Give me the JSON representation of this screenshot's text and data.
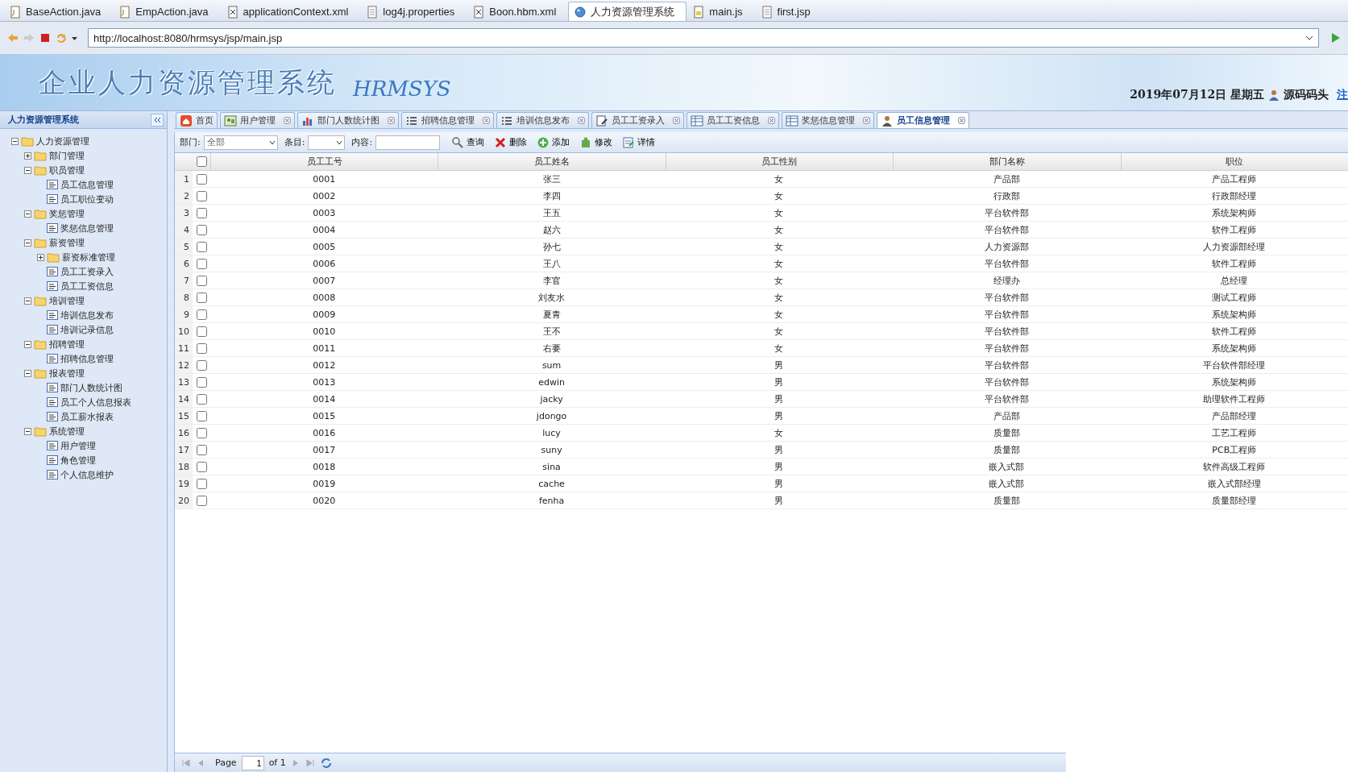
{
  "editor_tabs": [
    {
      "label": "BaseAction.java",
      "kind": "java",
      "selected": false
    },
    {
      "label": "EmpAction.java",
      "kind": "java",
      "selected": false
    },
    {
      "label": "applicationContext.xml",
      "kind": "xml",
      "selected": false
    },
    {
      "label": "log4j.properties",
      "kind": "text",
      "selected": false
    },
    {
      "label": "Boon.hbm.xml",
      "kind": "xml",
      "selected": false
    },
    {
      "label": "人力资源管理系统",
      "kind": "web",
      "selected": true
    },
    {
      "label": "main.js",
      "kind": "js",
      "selected": false
    },
    {
      "label": "first.jsp",
      "kind": "text",
      "selected": false
    }
  ],
  "address_bar": {
    "url": "http://localhost:8080/hrmsys/jsp/main.jsp"
  },
  "header": {
    "title": "企业人力资源管理系统",
    "subtitle": "HRMSYS",
    "date": "2019年07月12日 星期五",
    "user": "源码码头",
    "logout": "注"
  },
  "sidebar": {
    "title": "人力资源管理系统",
    "tree": [
      {
        "label": "人力资源管理",
        "kind": "folder",
        "expanded": true,
        "children": [
          {
            "label": "部门管理",
            "kind": "folder",
            "expanded": false
          },
          {
            "label": "职员管理",
            "kind": "folder",
            "expanded": true,
            "children": [
              {
                "label": "员工信息管理",
                "kind": "page"
              },
              {
                "label": "员工职位变动",
                "kind": "page"
              }
            ]
          },
          {
            "label": "奖惩管理",
            "kind": "folder",
            "expanded": true,
            "children": [
              {
                "label": "奖惩信息管理",
                "kind": "page"
              }
            ]
          },
          {
            "label": "薪资管理",
            "kind": "folder",
            "expanded": true,
            "children": [
              {
                "label": "薪资标准管理",
                "kind": "folder",
                "expanded": false
              },
              {
                "label": "员工工资录入",
                "kind": "page"
              },
              {
                "label": "员工工资信息",
                "kind": "page"
              }
            ]
          },
          {
            "label": "培训管理",
            "kind": "folder",
            "expanded": true,
            "children": [
              {
                "label": "培训信息发布",
                "kind": "page"
              },
              {
                "label": "培训记录信息",
                "kind": "page"
              }
            ]
          },
          {
            "label": "招聘管理",
            "kind": "folder",
            "expanded": true,
            "children": [
              {
                "label": "招聘信息管理",
                "kind": "page"
              }
            ]
          },
          {
            "label": "报表管理",
            "kind": "folder",
            "expanded": true,
            "children": [
              {
                "label": "部门人数统计图",
                "kind": "page"
              },
              {
                "label": "员工个人信息报表",
                "kind": "page"
              },
              {
                "label": "员工薪水报表",
                "kind": "page"
              }
            ]
          },
          {
            "label": "系统管理",
            "kind": "folder",
            "expanded": true,
            "children": [
              {
                "label": "用户管理",
                "kind": "page"
              },
              {
                "label": "角色管理",
                "kind": "page"
              },
              {
                "label": "个人信息维护",
                "kind": "page"
              }
            ]
          }
        ]
      }
    ]
  },
  "page_tabs": [
    {
      "label": "首页",
      "kind": "home",
      "closable": false,
      "selected": false
    },
    {
      "label": "用户管理",
      "kind": "users",
      "closable": true,
      "selected": false
    },
    {
      "label": "部门人数统计图",
      "kind": "chart",
      "closable": true,
      "selected": false
    },
    {
      "label": "招聘信息管理",
      "kind": "list",
      "closable": true,
      "selected": false
    },
    {
      "label": "培训信息发布",
      "kind": "list",
      "closable": true,
      "selected": false
    },
    {
      "label": "员工工资录入",
      "kind": "edit",
      "closable": true,
      "selected": false
    },
    {
      "label": "员工工资信息",
      "kind": "table",
      "closable": true,
      "selected": false
    },
    {
      "label": "奖惩信息管理",
      "kind": "table",
      "closable": true,
      "selected": false
    },
    {
      "label": "员工信息管理",
      "kind": "user",
      "closable": true,
      "selected": true
    }
  ],
  "toolbar": {
    "department_label": "部门:",
    "department_value": "全部",
    "item_label": "条目:",
    "content_label": "内容:",
    "buttons": [
      {
        "label": "查询",
        "kind": "search"
      },
      {
        "label": "删除",
        "kind": "delete"
      },
      {
        "label": "添加",
        "kind": "add"
      },
      {
        "label": "修改",
        "kind": "edit"
      },
      {
        "label": "详情",
        "kind": "detail"
      }
    ]
  },
  "table": {
    "all_checked": false,
    "columns": [
      "员工工号",
      "员工姓名",
      "员工性别",
      "部门名称",
      "职位"
    ],
    "rows": [
      {
        "num": "1",
        "checked": false,
        "cells": [
          "0001",
          "张三",
          "女",
          "产品部",
          "产品工程师"
        ]
      },
      {
        "num": "2",
        "checked": false,
        "cells": [
          "0002",
          "李四",
          "女",
          "行政部",
          "行政部经理"
        ]
      },
      {
        "num": "3",
        "checked": false,
        "cells": [
          "0003",
          "王五",
          "女",
          "平台软件部",
          "系统架构师"
        ]
      },
      {
        "num": "4",
        "checked": false,
        "cells": [
          "0004",
          "赵六",
          "女",
          "平台软件部",
          "软件工程师"
        ]
      },
      {
        "num": "5",
        "checked": false,
        "cells": [
          "0005",
          "孙七",
          "女",
          "人力资源部",
          "人力资源部经理"
        ]
      },
      {
        "num": "6",
        "checked": false,
        "cells": [
          "0006",
          "王八",
          "女",
          "平台软件部",
          "软件工程师"
        ]
      },
      {
        "num": "7",
        "checked": false,
        "cells": [
          "0007",
          "李官",
          "女",
          "经理办",
          "总经理"
        ]
      },
      {
        "num": "8",
        "checked": false,
        "cells": [
          "0008",
          "刘友水",
          "女",
          "平台软件部",
          "测试工程师"
        ]
      },
      {
        "num": "9",
        "checked": false,
        "cells": [
          "0009",
          "夏青",
          "女",
          "平台软件部",
          "系统架构师"
        ]
      },
      {
        "num": "10",
        "checked": false,
        "cells": [
          "0010",
          "王不",
          "女",
          "平台软件部",
          "软件工程师"
        ]
      },
      {
        "num": "11",
        "checked": false,
        "cells": [
          "0011",
          "右要",
          "女",
          "平台软件部",
          "系统架构师"
        ]
      },
      {
        "num": "12",
        "checked": false,
        "cells": [
          "0012",
          "sum",
          "男",
          "平台软件部",
          "平台软件部经理"
        ]
      },
      {
        "num": "13",
        "checked": false,
        "cells": [
          "0013",
          "edwin",
          "男",
          "平台软件部",
          "系统架构师"
        ]
      },
      {
        "num": "14",
        "checked": false,
        "cells": [
          "0014",
          "jacky",
          "男",
          "平台软件部",
          "助理软件工程师"
        ]
      },
      {
        "num": "15",
        "checked": false,
        "cells": [
          "0015",
          "jdongo",
          "男",
          "产品部",
          "产品部经理"
        ]
      },
      {
        "num": "16",
        "checked": false,
        "cells": [
          "0016",
          "lucy",
          "女",
          "质量部",
          "工艺工程师"
        ]
      },
      {
        "num": "17",
        "checked": false,
        "cells": [
          "0017",
          "suny",
          "男",
          "质量部",
          "PCB工程师"
        ]
      },
      {
        "num": "18",
        "checked": false,
        "cells": [
          "0018",
          "sina",
          "男",
          "嵌入式部",
          "软件高级工程师"
        ]
      },
      {
        "num": "19",
        "checked": false,
        "cells": [
          "0019",
          "cache",
          "男",
          "嵌入式部",
          "嵌入式部经理"
        ]
      },
      {
        "num": "20",
        "checked": false,
        "cells": [
          "0020",
          "fenha",
          "男",
          "质量部",
          "质量部经理"
        ]
      }
    ]
  },
  "pager": {
    "page_label": "Page",
    "page_value": "1",
    "of_label": "of 1"
  }
}
